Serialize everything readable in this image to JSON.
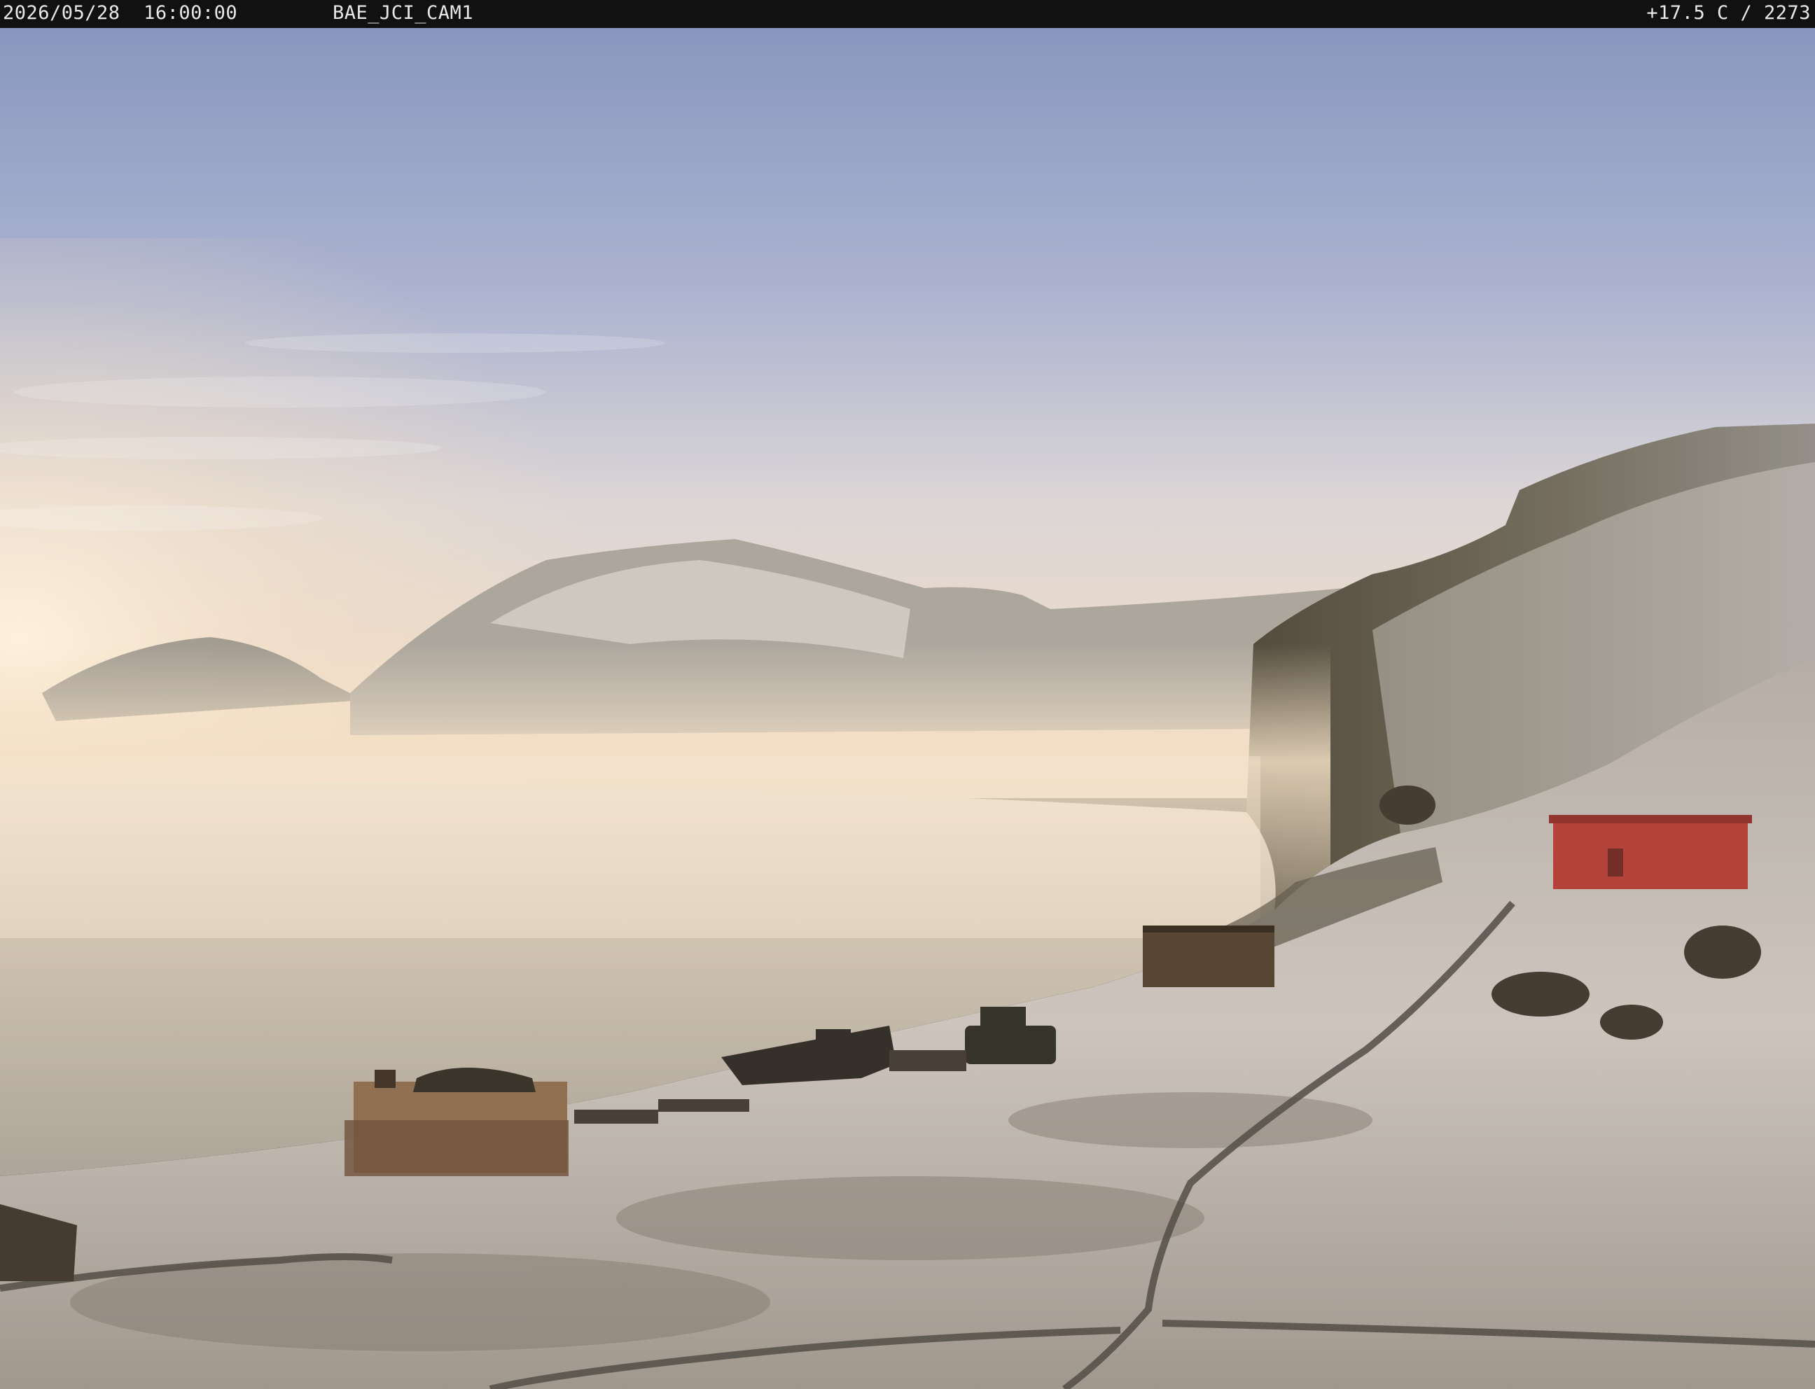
{
  "overlay": {
    "timestamp": "2026/05/28  16:00:00",
    "camera_id": "BAE_JCI_CAM1",
    "readout": "+17.5 C / 2273"
  },
  "scene": {
    "colors": {
      "sky_top": "#8a98c4",
      "sky_horizon": "#f2dcc4",
      "fog": "#f6e6cf",
      "water": "#bdb3a6",
      "snow": "#d8d2cc",
      "rock": "#3b3428",
      "hut_red": "#b8302c"
    }
  }
}
